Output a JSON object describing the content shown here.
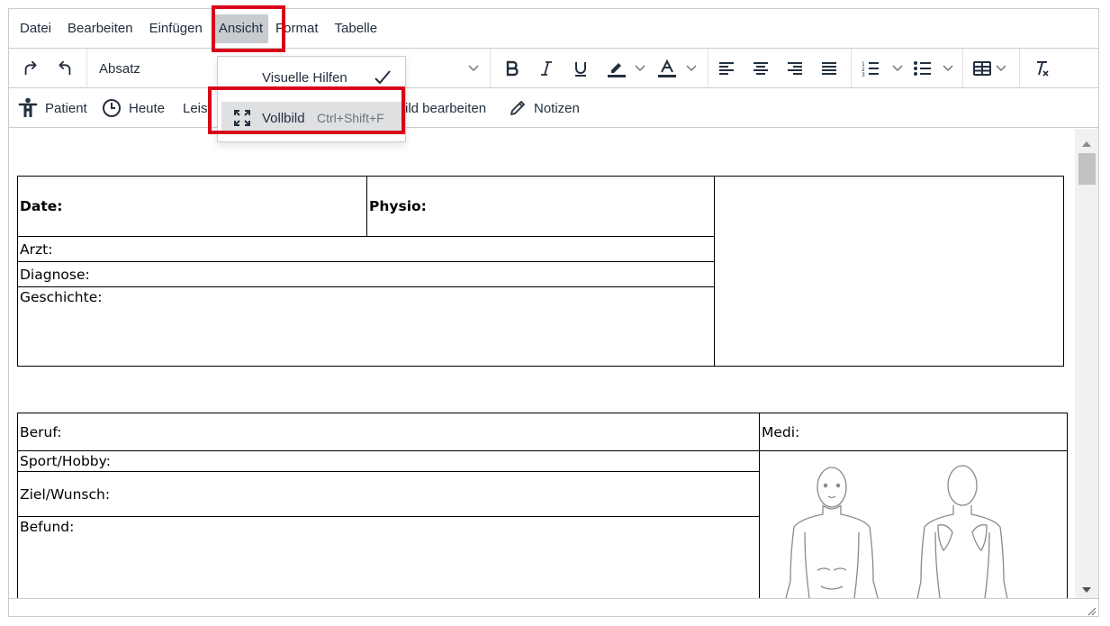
{
  "menubar": {
    "items": [
      {
        "label": "Datei"
      },
      {
        "label": "Bearbeiten"
      },
      {
        "label": "Einfügen"
      },
      {
        "label": "Ansicht"
      },
      {
        "label": "Format"
      },
      {
        "label": "Tabelle"
      }
    ]
  },
  "toolbar": {
    "block_format": "Absatz"
  },
  "toolbar2": {
    "patient": "Patient",
    "heute": "Heute",
    "leistung": "Leist",
    "bild_bearbeiten": "Bild bearbeiten",
    "notizen": "Notizen"
  },
  "view_menu": {
    "visual_aids": "Visuelle Hilfen",
    "fullscreen": "Vollbild",
    "fullscreen_shortcut": "Ctrl+Shift+F"
  },
  "document": {
    "table1": {
      "date": "Date:",
      "physio": "Physio:",
      "arzt": "Arzt:",
      "diagnose": "Diagnose:",
      "geschichte": "Geschichte:"
    },
    "table2": {
      "beruf": "Beruf:",
      "medi": "Medi:",
      "sport": "Sport/Hobby:",
      "ziel": "Ziel/Wunsch:",
      "befund": "Befund:"
    }
  },
  "colors": {
    "highlight": "#d8001a",
    "menu_active": "#c8cbcf",
    "menu_item_hover": "#dee0e2",
    "text": "#222f3e"
  }
}
